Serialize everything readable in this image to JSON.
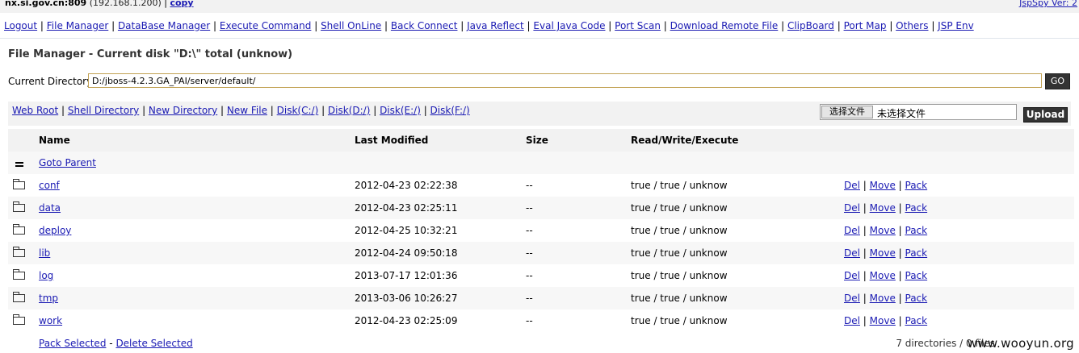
{
  "topbar": {
    "host": "nx.si.gov.cn:809",
    "ip": "(192.168.1.200)",
    "copy": "copy",
    "version": "JspSpy Ver: 2"
  },
  "nav": [
    "Logout",
    "File Manager",
    "DataBase Manager",
    "Execute Command",
    "Shell OnLine",
    "Back Connect",
    "Java Reflect",
    "Eval Java Code",
    "Port Scan",
    "Download Remote File",
    "ClipBoard",
    "Port Map",
    "Others",
    "JSP Env"
  ],
  "title": "File Manager - Current disk \"D:\\\" total (unknow)",
  "current_directory": {
    "label": "Current Directory",
    "value": "D:/jboss-4.2.3.GA_PAI/server/default/",
    "go": "GO"
  },
  "quick_links": [
    "Web Root",
    "Shell Directory",
    "New Directory",
    "New File",
    "Disk(C:/)",
    "Disk(D:/)",
    "Disk(E:/)",
    "Disk(F:/)"
  ],
  "upload": {
    "choose": "选择文件",
    "no_file": "未选择文件",
    "button": "Upload"
  },
  "table": {
    "headers": {
      "name": "Name",
      "modified": "Last Modified",
      "size": "Size",
      "rwx": "Read/Write/Execute"
    },
    "parent": "Goto Parent",
    "rows": [
      {
        "name": "conf",
        "modified": "2012-04-23 02:22:38",
        "size": "--",
        "rwx": "true / true / unknow"
      },
      {
        "name": "data",
        "modified": "2012-04-23 02:25:11",
        "size": "--",
        "rwx": "true / true / unknow"
      },
      {
        "name": "deploy",
        "modified": "2012-04-25 10:32:21",
        "size": "--",
        "rwx": "true / true / unknow"
      },
      {
        "name": "lib",
        "modified": "2012-04-24 09:50:18",
        "size": "--",
        "rwx": "true / true / unknow"
      },
      {
        "name": "log",
        "modified": "2013-07-17 12:01:36",
        "size": "--",
        "rwx": "true / true / unknow"
      },
      {
        "name": "tmp",
        "modified": "2013-03-06 10:26:27",
        "size": "--",
        "rwx": "true / true / unknow"
      },
      {
        "name": "work",
        "modified": "2012-04-23 02:25:09",
        "size": "--",
        "rwx": "true / true / unknow"
      }
    ],
    "actions": {
      "del": "Del",
      "move": "Move",
      "pack": "Pack"
    }
  },
  "footer": {
    "pack_selected": "Pack Selected",
    "delete_selected": "Delete Selected",
    "dash": "-",
    "count": "7 directories / 0 files"
  },
  "watermark": "www.wooyun.org"
}
